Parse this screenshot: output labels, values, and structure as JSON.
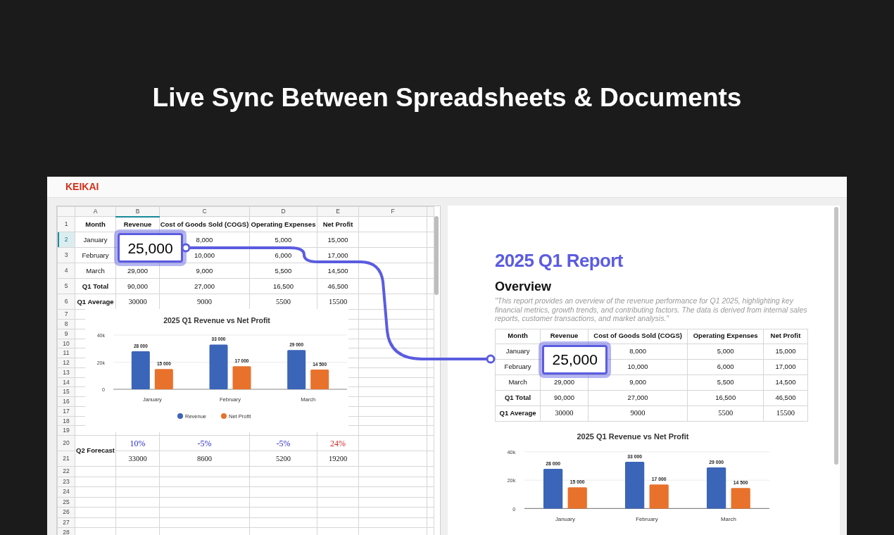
{
  "page_title": "Live Sync Between Spreadsheets & Documents",
  "app": {
    "logo": "KEIKAI"
  },
  "sheet": {
    "columns": [
      {
        "label": "A",
        "selected": false
      },
      {
        "label": "B",
        "selected": true
      },
      {
        "label": "C",
        "selected": false
      },
      {
        "label": "D",
        "selected": false
      },
      {
        "label": "E",
        "selected": false
      },
      {
        "label": "F",
        "selected": false
      }
    ],
    "rows": [
      {
        "number": "1",
        "selected": false,
        "kind": "header",
        "cells": [
          "Month",
          "Revenue",
          "Cost of Goods Sold (COGS)",
          "Operating Expenses",
          "Net Profit"
        ]
      },
      {
        "number": "2",
        "selected": true,
        "kind": "value",
        "cells": [
          "January",
          null,
          "8,000",
          "5,000",
          "15,000"
        ],
        "callout": "25,000"
      },
      {
        "number": "3",
        "selected": false,
        "kind": "value",
        "cells": [
          "February",
          null,
          "10,000",
          "6,000",
          "17,000"
        ]
      },
      {
        "number": "4",
        "selected": false,
        "kind": "value",
        "cells": [
          "March",
          "29,000",
          "9,000",
          "5,500",
          "14,500"
        ]
      },
      {
        "number": "5",
        "selected": false,
        "kind": "summary",
        "cells": [
          "Q1 Total",
          "90,000",
          "27,000",
          "16,500",
          "46,500"
        ]
      },
      {
        "number": "6",
        "selected": false,
        "kind": "average",
        "cells": [
          "Q1 Average",
          "30000",
          "9000",
          "5500",
          "15500"
        ]
      },
      {
        "number": "7",
        "selected": false,
        "kind": "chart"
      },
      {
        "number": "8",
        "selected": false,
        "kind": "chart"
      },
      {
        "number": "9",
        "selected": false,
        "kind": "chart"
      },
      {
        "number": "10",
        "selected": false,
        "kind": "chart"
      },
      {
        "number": "11",
        "selected": false,
        "kind": "chart"
      },
      {
        "number": "12",
        "selected": false,
        "kind": "chart"
      },
      {
        "number": "13",
        "selected": false,
        "kind": "chart"
      },
      {
        "number": "14",
        "selected": false,
        "kind": "chart"
      },
      {
        "number": "15",
        "selected": false,
        "kind": "chart"
      },
      {
        "number": "16",
        "selected": false,
        "kind": "chart"
      },
      {
        "number": "17",
        "selected": false,
        "kind": "chart"
      },
      {
        "number": "18",
        "selected": false,
        "kind": "chart"
      },
      {
        "number": "19",
        "selected": false,
        "kind": "chart"
      },
      {
        "number": "20",
        "selected": false,
        "kind": "forecast_rate",
        "label": "Q2 Forecast",
        "cells": [
          {
            "text": "10%",
            "color": "#2b2bcf"
          },
          {
            "text": "-5%",
            "color": "#2b2bcf"
          },
          {
            "text": "-5%",
            "color": "#2b2bcf"
          },
          {
            "text": "24%",
            "color": "#d42a2a"
          }
        ]
      },
      {
        "number": "21",
        "selected": false,
        "kind": "forecast_value",
        "cells": [
          "33000",
          "8600",
          "5200",
          "19200"
        ]
      },
      {
        "number": "22",
        "selected": false,
        "kind": "blank"
      },
      {
        "number": "23",
        "selected": false,
        "kind": "blank"
      },
      {
        "number": "24",
        "selected": false,
        "kind": "blank"
      },
      {
        "number": "25",
        "selected": false,
        "kind": "blank"
      },
      {
        "number": "26",
        "selected": false,
        "kind": "blank"
      },
      {
        "number": "27",
        "selected": false,
        "kind": "blank"
      },
      {
        "number": "28",
        "selected": false,
        "kind": "blank"
      }
    ],
    "chart_data": {
      "type": "bar",
      "title": "2025 Q1 Revenue vs Net Profit",
      "categories": [
        "January",
        "February",
        "March"
      ],
      "series": [
        {
          "name": "Revenue",
          "color": "#3b65b9",
          "values": [
            28000,
            33000,
            29000
          ]
        },
        {
          "name": "Net Profit",
          "color": "#e8722c",
          "values": [
            15000,
            17000,
            14500
          ]
        }
      ],
      "ylim": [
        0,
        40000
      ],
      "yticks": [
        {
          "value": 0,
          "label": "0"
        },
        {
          "value": 20000,
          "label": "20k"
        },
        {
          "value": 40000,
          "label": "40k"
        }
      ],
      "legend": "bottom",
      "value_labels": [
        [
          "28 000",
          "33 000",
          "29 000"
        ],
        [
          "15 000",
          "17 000",
          "14 500"
        ]
      ]
    }
  },
  "document": {
    "title": "2025 Q1 Report",
    "heading": "Overview",
    "quote": "\"This report provides an overview of the revenue performance for Q1 2025, highlighting key financial metrics, growth trends, and contributing factors. The data is derived from internal sales reports, customer transactions, and market analysis.\"",
    "table": {
      "columns": [
        "Month",
        "Revenue",
        "Cost of Goods Sold (COGS)",
        "Operating Expenses",
        "Net Profit"
      ],
      "rows": [
        {
          "kind": "value",
          "cells": [
            "January",
            null,
            "8,000",
            "5,000",
            "15,000"
          ],
          "callout": "25,000"
        },
        {
          "kind": "value",
          "cells": [
            "February",
            null,
            "10,000",
            "6,000",
            "17,000"
          ]
        },
        {
          "kind": "value",
          "cells": [
            "March",
            "29,000",
            "9,000",
            "5,500",
            "14,500"
          ]
        },
        {
          "kind": "summary",
          "cells": [
            "Q1 Total",
            "90,000",
            "27,000",
            "16,500",
            "46,500"
          ]
        },
        {
          "kind": "average",
          "cells": [
            "Q1 Average",
            "30000",
            "9000",
            "5500",
            "15500"
          ]
        }
      ]
    },
    "chart_data": {
      "type": "bar",
      "title": "2025 Q1 Revenue vs Net Profit",
      "categories": [
        "January",
        "February",
        "March"
      ],
      "series": [
        {
          "color": "#3b65b9",
          "values": [
            28000,
            33000,
            29000
          ]
        },
        {
          "color": "#e8722c",
          "values": [
            15000,
            17000,
            14500
          ]
        }
      ],
      "ylim": [
        0,
        40000
      ],
      "yticks": [
        {
          "value": 0,
          "label": "0"
        },
        {
          "value": 20000,
          "label": "20k"
        },
        {
          "value": 40000,
          "label": "40k"
        }
      ],
      "value_labels": [
        [
          "28 000",
          "33 000",
          "29 000"
        ],
        [
          "15 000",
          "17 000",
          "14 500"
        ]
      ]
    }
  }
}
